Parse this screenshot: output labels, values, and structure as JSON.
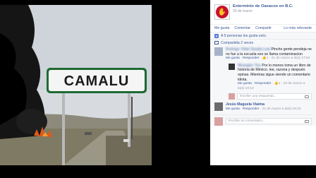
{
  "post": {
    "page_name": "Exterminio de Oaxacos en B.C.",
    "date": "20 de marzo",
    "sign_text": "CAMALU"
  },
  "actions": {
    "like": "Me gusta",
    "comment": "Comentar",
    "share": "Compartir",
    "more": "Lo más relevante"
  },
  "likes_text": "A 9 personas les gusta esto.",
  "shares_text": "Compartida 2 veces",
  "comments": [
    {
      "author": "Rodrigo Vidal Zavala Leal",
      "text": "Pincho gente pendeja ne no fue a la escuela eso se llama contaminacion",
      "meta_like": "Me gusta",
      "meta_reply": "Responder",
      "meta_count": "1",
      "meta_time": "21 de marzo a la(s) 17:54"
    },
    {
      "author": "Wrangler Ton",
      "text": "Por lo menos toma un libro de historia de México. lee, razona y después opinas. Mientras sigue siendo un comentario idiota.",
      "meta_like": "Me gusta",
      "meta_reply": "Responder",
      "meta_count": "1",
      "meta_time": "23 de marzo a la(s) 19:10"
    },
    {
      "author": "Jesús Maguela Viaima",
      "text": "",
      "meta_like": "Me gusta",
      "meta_reply": "Responder",
      "meta_count": "",
      "meta_time": "21 de marzo a la(s) 19:23"
    }
  ],
  "reply_placeholder": "Escribe una respuesta...",
  "comment_placeholder": "Escribe un comentario..."
}
